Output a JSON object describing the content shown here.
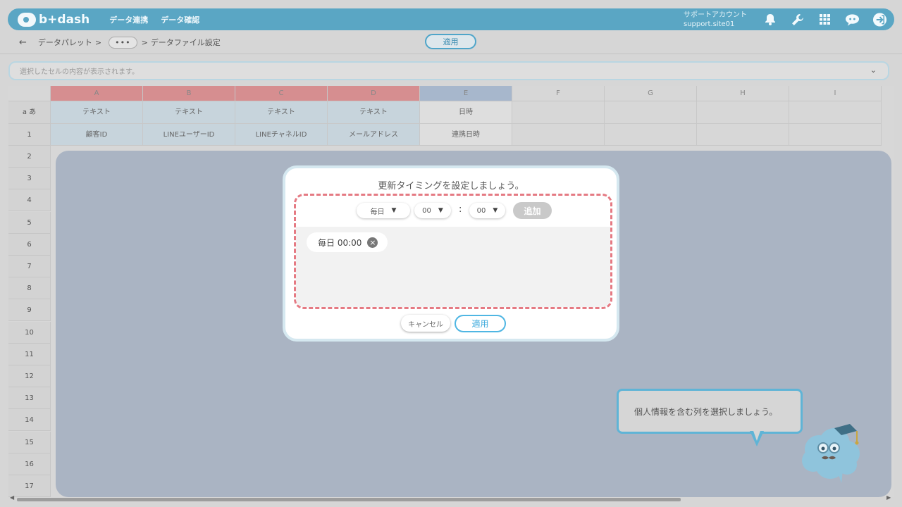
{
  "header": {
    "logo": "b+dash",
    "nav": [
      "データ連携",
      "データ確認"
    ],
    "account_name": "サポートアカウント",
    "account_id": "support.site01"
  },
  "breadcrumb": {
    "back": "←",
    "root": "データパレット",
    "sep": ">",
    "dots": "•••",
    "sep2": ">",
    "current": "データファイル設定"
  },
  "top_apply": "適用",
  "cell_bar": {
    "placeholder": "選択したセルの内容が表示されます。"
  },
  "grid": {
    "columns": [
      "A",
      "B",
      "C",
      "D",
      "E",
      "F",
      "G",
      "H",
      "I"
    ],
    "type_row_label": "a あ",
    "types": [
      "テキスト",
      "テキスト",
      "テキスト",
      "テキスト",
      "日時",
      "",
      "",
      "",
      ""
    ],
    "header_row": [
      "顧客ID",
      "LINEユーザーID",
      "LINEチャネルID",
      "メールアドレス",
      "連携日時",
      "",
      "",
      "",
      ""
    ],
    "rows": [
      "1",
      "2",
      "3",
      "4",
      "5",
      "6",
      "7",
      "8",
      "9",
      "10",
      "11",
      "12",
      "13",
      "14",
      "15",
      "16",
      "17"
    ]
  },
  "modal": {
    "title": "更新タイミングを設定しましょう。",
    "frequency": "毎日",
    "hour": "00",
    "colon": ":",
    "minute": "00",
    "add_label": "追加",
    "schedules": [
      "毎日 00:00"
    ],
    "cancel_label": "キャンセル",
    "apply_label": "適用"
  },
  "hint": {
    "text": "個人情報を含む列を選択しましょう。"
  },
  "colors": {
    "header_bg": "#5aa6c4",
    "dashed_border": "#e57a83",
    "accent": "#4fb6e3"
  }
}
